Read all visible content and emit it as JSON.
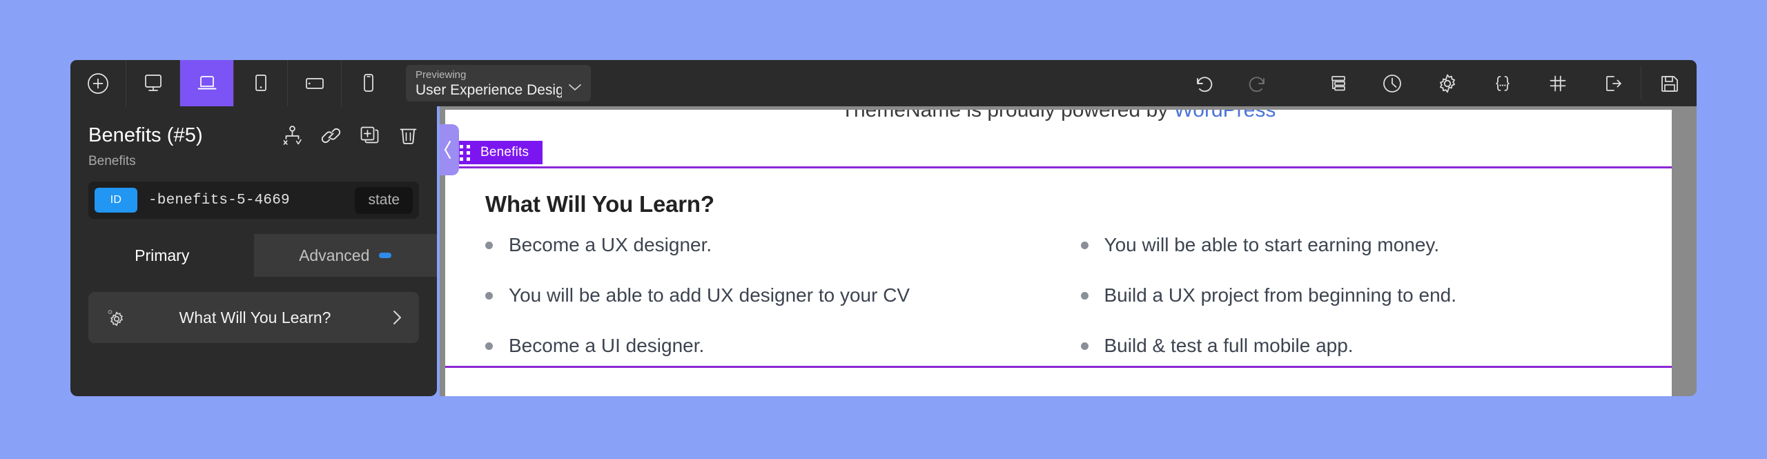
{
  "toolbar": {
    "add_button": "add-section",
    "devices": [
      {
        "name": "desktop",
        "label": "Desktop",
        "active": false
      },
      {
        "name": "laptop",
        "label": "Laptop",
        "active": true
      },
      {
        "name": "tablet",
        "label": "Tablet",
        "active": false
      },
      {
        "name": "tablet-landscape",
        "label": "Tablet Landscape",
        "active": false
      },
      {
        "name": "mobile",
        "label": "Mobile",
        "active": false
      }
    ],
    "preview": {
      "label": "Previewing",
      "value": "User Experience Desig"
    },
    "actions": [
      {
        "name": "undo",
        "label": "Undo",
        "dim": false
      },
      {
        "name": "redo",
        "label": "Redo",
        "dim": true
      },
      {
        "name": "layers",
        "label": "Structure",
        "dim": false
      },
      {
        "name": "history",
        "label": "History",
        "dim": false
      },
      {
        "name": "settings",
        "label": "Settings",
        "dim": false
      },
      {
        "name": "custom-code",
        "label": "Custom Code",
        "dim": false
      },
      {
        "name": "grid",
        "label": "Grid",
        "dim": false
      },
      {
        "name": "exit",
        "label": "Exit",
        "dim": false
      },
      {
        "name": "save",
        "label": "Save",
        "dim": false
      }
    ]
  },
  "panel": {
    "title": "Benefits (#5)",
    "subtitle": "Benefits",
    "head_icons": [
      {
        "name": "ab-test",
        "label": "A/B Test"
      },
      {
        "name": "link",
        "label": "Link"
      },
      {
        "name": "duplicate",
        "label": "Duplicate"
      },
      {
        "name": "delete",
        "label": "Delete"
      }
    ],
    "id_row": {
      "badge": "ID",
      "value": "-benefits-5-4669",
      "state_button": "state"
    },
    "tabs": [
      {
        "label": "Primary",
        "active": true,
        "badge": false
      },
      {
        "label": "Advanced",
        "active": false,
        "badge": true
      }
    ],
    "options": [
      {
        "icon": "gear-icon",
        "label": "What Will You Learn?"
      }
    ]
  },
  "canvas": {
    "footer_credit_prefix": "ThemeName is proudly powered by ",
    "footer_credit_link": "WordPress",
    "section_badge": "Benefits",
    "heading": "What Will You Learn?",
    "columns": [
      {
        "items": [
          "Become a UX designer.",
          "You will be able to add UX designer to your CV",
          "Become a UI designer."
        ]
      },
      {
        "items": [
          "You will be able to start earning money.",
          "Build a UX project from beginning to end.",
          "Build & test a full mobile app."
        ]
      }
    ]
  },
  "colors": {
    "accent_purple": "#7c54f5",
    "section_outline": "#8c27d6",
    "badge_blue": "#2196f3",
    "page_background": "#89a1f7",
    "toolbar_bg": "#2b2b2b"
  }
}
